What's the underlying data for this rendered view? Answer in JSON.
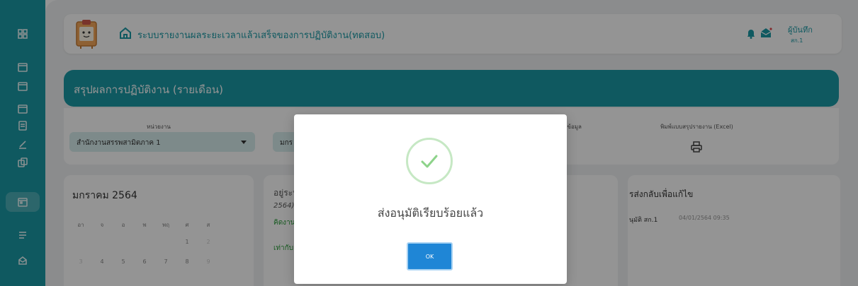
{
  "header": {
    "app_title": "ระบบรายงานผลระยะเวลาแล้วเสร็จของการปฏิบัติงาน(ทดสอบ)",
    "user_name": "ผู้บันทึก",
    "user_role": "สก.1"
  },
  "page": {
    "title": "สรุปผลการปฏิบัติงาน (รายเดือน)"
  },
  "filters": {
    "unit_label": "หน่วยงาน",
    "unit_value": "สำนักงานสรรพสามิตภาค 1",
    "month_value": "มกร",
    "data_label": "มัติข้อมูล",
    "export_label": "พิมพ์แบบสรุปรายงาน (Excel)"
  },
  "calendar": {
    "title": "มกราคม 2564",
    "weekdays": [
      "อา",
      "จ",
      "อ",
      "พ",
      "พฤ",
      "ศ",
      "ส"
    ],
    "row1": [
      "",
      "",
      "",
      "",
      "",
      "1",
      "2"
    ],
    "row2": [
      "3",
      "4",
      "5",
      "6",
      "7",
      "8",
      "9"
    ]
  },
  "middle": {
    "line1": "อยู่ระห",
    "line2": "2564)",
    "line3": "คิดงานา",
    "line4": "เท่ากับแ"
  },
  "right": {
    "heading": "รส่งกลับเพื่อแก้ไข",
    "item_name": "นุมัติ สก.1",
    "item_time": "04/01/2564 09:35"
  },
  "modal": {
    "message": "ส่งอนุมัติเรียบร้อยแล้ว",
    "ok_label": "OK"
  },
  "colors": {
    "primary": "#1b9aa6",
    "ok_button": "#1f86d6",
    "success": "#8dd38a"
  },
  "icons": {
    "sidebar": [
      "dashboard-icon",
      "calendar-icon",
      "calendar-icon",
      "calendar-icon",
      "document-icon",
      "pen-icon",
      "copy-icon",
      "calendar-icon",
      "list-icon",
      "mail-icon"
    ],
    "header": [
      "home-icon",
      "bell-icon",
      "mail-icon"
    ],
    "modal": "check-icon",
    "export": "printer-icon"
  }
}
